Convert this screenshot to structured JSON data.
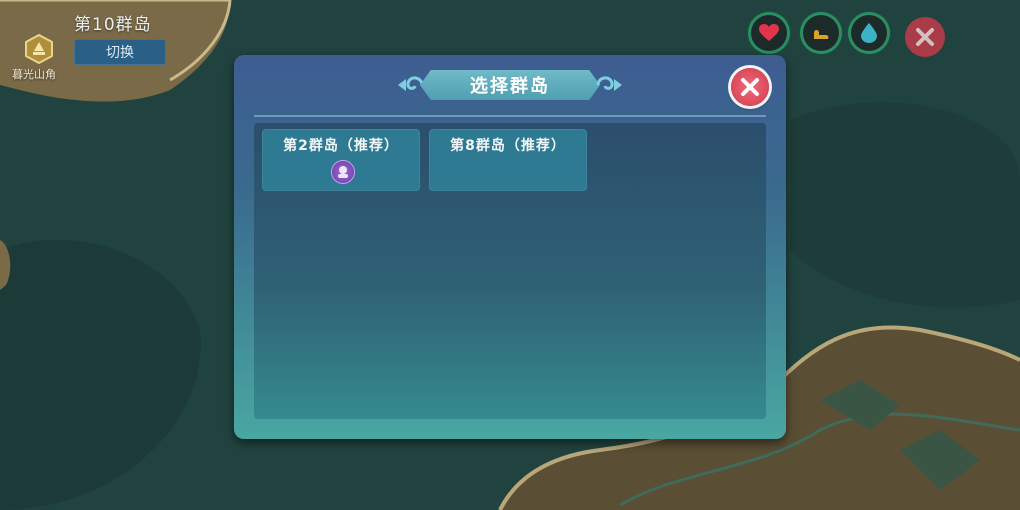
{
  "hud": {
    "island_title": "第10群岛",
    "switch_label": "切换",
    "location_name": "暮光山角",
    "status_icons": [
      "heart-icon",
      "boot-icon",
      "water-drop-icon"
    ],
    "close_icon": "close-icon"
  },
  "dialog": {
    "title": "选择群岛",
    "close_icon": "close-icon",
    "islands": [
      {
        "label": "第2群岛（推荐）",
        "has_badge": true,
        "badge_icon": "avatar-badge-icon"
      },
      {
        "label": "第8群岛（推荐）",
        "has_badge": false
      }
    ]
  },
  "colors": {
    "dialog_top": "#3e5d92",
    "dialog_bottom": "#49a7a1",
    "card": "#2f7a93",
    "close_red": "#d13a4d"
  }
}
